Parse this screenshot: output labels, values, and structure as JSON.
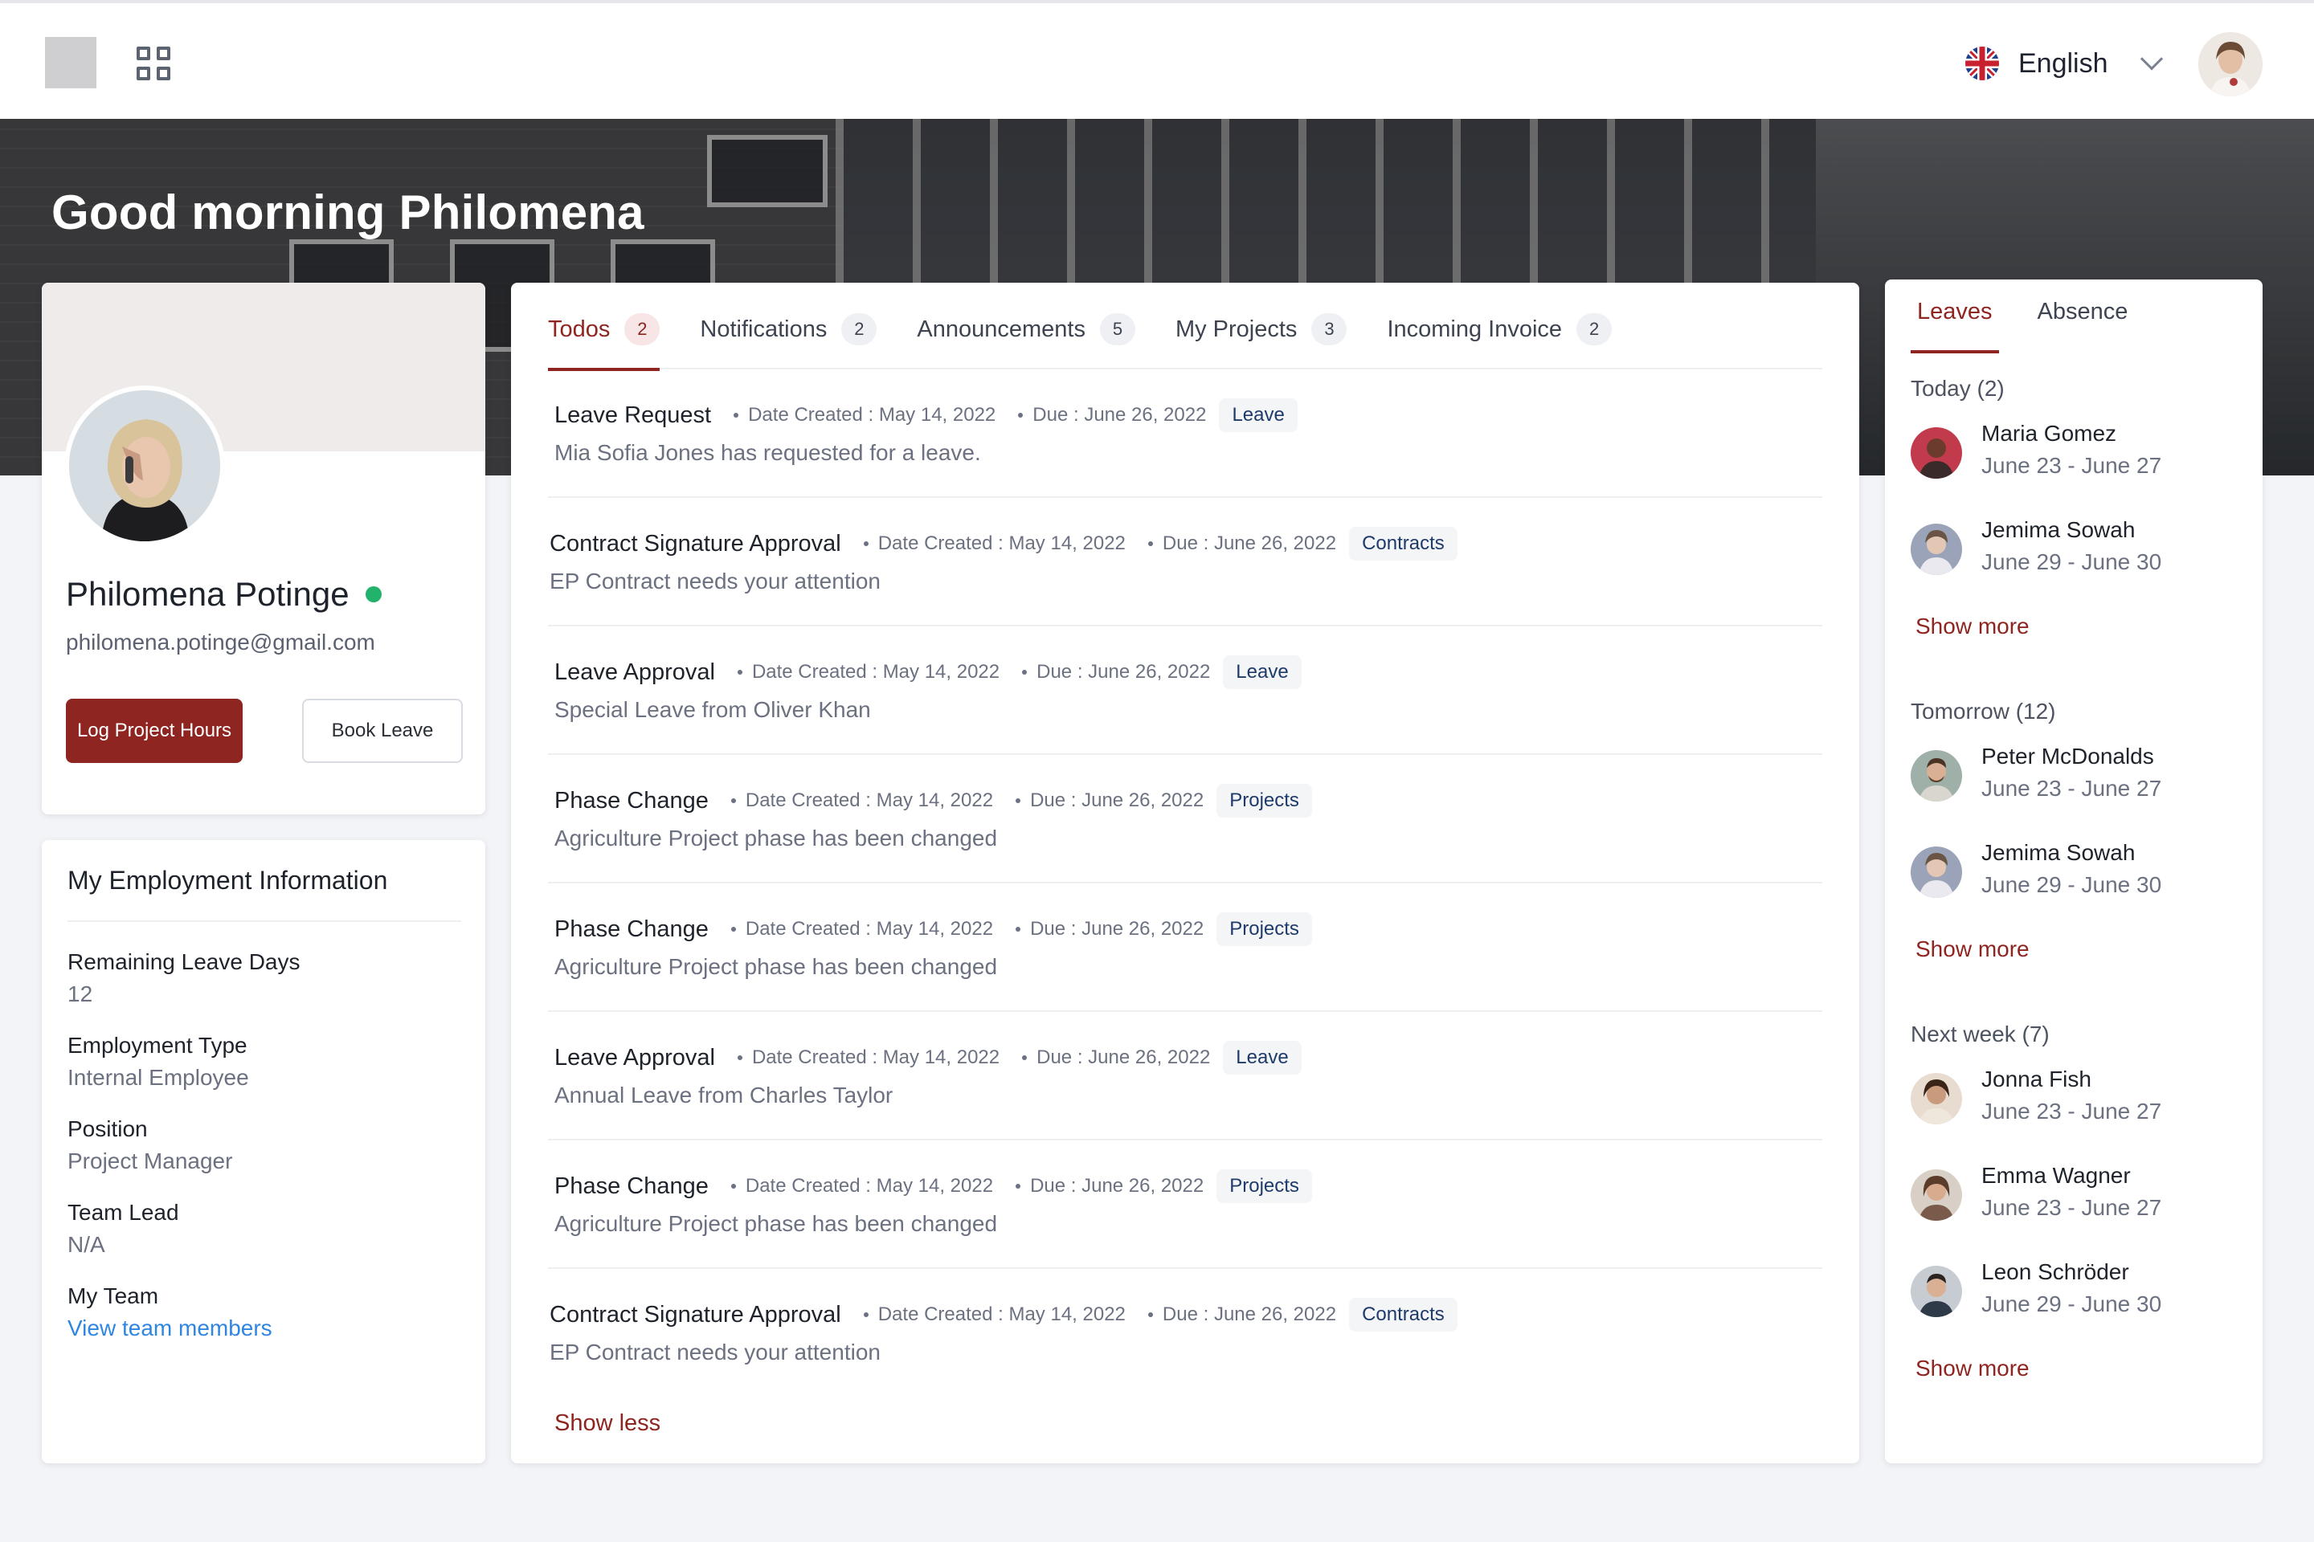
{
  "topbar": {
    "language": "English",
    "icons": {
      "apps": "grid-icon",
      "flag": "uk-flag-icon",
      "dropdown": "chevron-down-icon"
    }
  },
  "hero": {
    "greeting": "Good morning Philomena"
  },
  "profile": {
    "name": "Philomena Potinge",
    "email": "philomena.potinge@gmail.com",
    "status_color": "#21b36b",
    "log_hours_label": "Log Project Hours",
    "book_leave_label": "Book Leave"
  },
  "employment": {
    "title": "My Employment Information",
    "items": [
      {
        "label": "Remaining Leave Days",
        "value": "12"
      },
      {
        "label": "Employment Type",
        "value": "Internal Employee"
      },
      {
        "label": "Position",
        "value": "Project Manager"
      },
      {
        "label": "Team Lead",
        "value": "N/A"
      },
      {
        "label": "My Team",
        "value": "View team members"
      }
    ]
  },
  "tasks": {
    "tabs": [
      {
        "label": "Todos",
        "count": "2",
        "active": true
      },
      {
        "label": "Notifications",
        "count": "2"
      },
      {
        "label": "Announcements",
        "count": "5"
      },
      {
        "label": "My Projects",
        "count": "3"
      },
      {
        "label": "Incoming Invoice",
        "count": "2"
      }
    ],
    "items": [
      {
        "title": "Leave Request",
        "created": "Date Created : May 14, 2022",
        "due": "Due : June 26, 2022",
        "tag": "Leave",
        "desc": "Mia Sofia Jones has requested for a leave."
      },
      {
        "title": "Contract Signature Approval",
        "created": "Date Created : May 14, 2022",
        "due": "Due : June 26, 2022",
        "tag": "Contracts",
        "desc": "EP Contract needs your attention"
      },
      {
        "title": "Leave Approval",
        "created": "Date Created : May 14, 2022",
        "due": "Due : June 26, 2022",
        "tag": "Leave",
        "desc": "Special Leave from Oliver Khan"
      },
      {
        "title": "Phase Change",
        "created": "Date Created : May 14, 2022",
        "due": "Due : June 26, 2022",
        "tag": "Projects",
        "desc": "Agriculture Project phase has been changed"
      },
      {
        "title": "Phase Change",
        "created": "Date Created : May 14, 2022",
        "due": "Due : June 26, 2022",
        "tag": "Projects",
        "desc": "Agriculture Project phase has been changed"
      },
      {
        "title": "Leave Approval",
        "created": "Date Created : May 14, 2022",
        "due": "Due : June 26, 2022",
        "tag": "Leave",
        "desc": "Annual Leave from Charles Taylor"
      },
      {
        "title": "Phase Change",
        "created": "Date Created : May 14, 2022",
        "due": "Due : June 26, 2022",
        "tag": "Projects",
        "desc": "Agriculture Project phase has been changed"
      },
      {
        "title": "Contract Signature Approval",
        "created": "Date Created : May 14, 2022",
        "due": "Due : June 26, 2022",
        "tag": "Contracts",
        "desc": "EP Contract needs your attention"
      }
    ],
    "show_less": "Show less"
  },
  "leaves": {
    "tabs": [
      {
        "label": "Leaves",
        "active": true
      },
      {
        "label": "Absence"
      }
    ],
    "groups": [
      {
        "title": "Today (2)",
        "people": [
          {
            "name": "Maria Gomez",
            "dates": "June 23 - June 27",
            "color": "#c23b4d"
          },
          {
            "name": "Jemima Sowah",
            "dates": "June 29 - June 30",
            "color": "#9aa3b8"
          }
        ],
        "more": "Show more"
      },
      {
        "title": "Tomorrow (12)",
        "people": [
          {
            "name": "Peter McDonalds",
            "dates": "June 23 - June 27",
            "color": "#7d8a86"
          },
          {
            "name": "Jemima Sowah",
            "dates": "June 29 - June 30",
            "color": "#9aa3b8"
          }
        ],
        "more": "Show more"
      },
      {
        "title": "Next week (7)",
        "people": [
          {
            "name": "Jonna Fish",
            "dates": "June 23 - June 27",
            "color": "#b89a82"
          },
          {
            "name": "Emma Wagner",
            "dates": "June 23 - June 27",
            "color": "#a07a6a"
          },
          {
            "name": "Leon Schröder",
            "dates": "June 29 - June 30",
            "color": "#4a5566"
          }
        ],
        "more": "Show more"
      }
    ]
  },
  "colors": {
    "accent": "#8e2520",
    "link": "#2f86e0",
    "background": "#f3f4f7"
  }
}
